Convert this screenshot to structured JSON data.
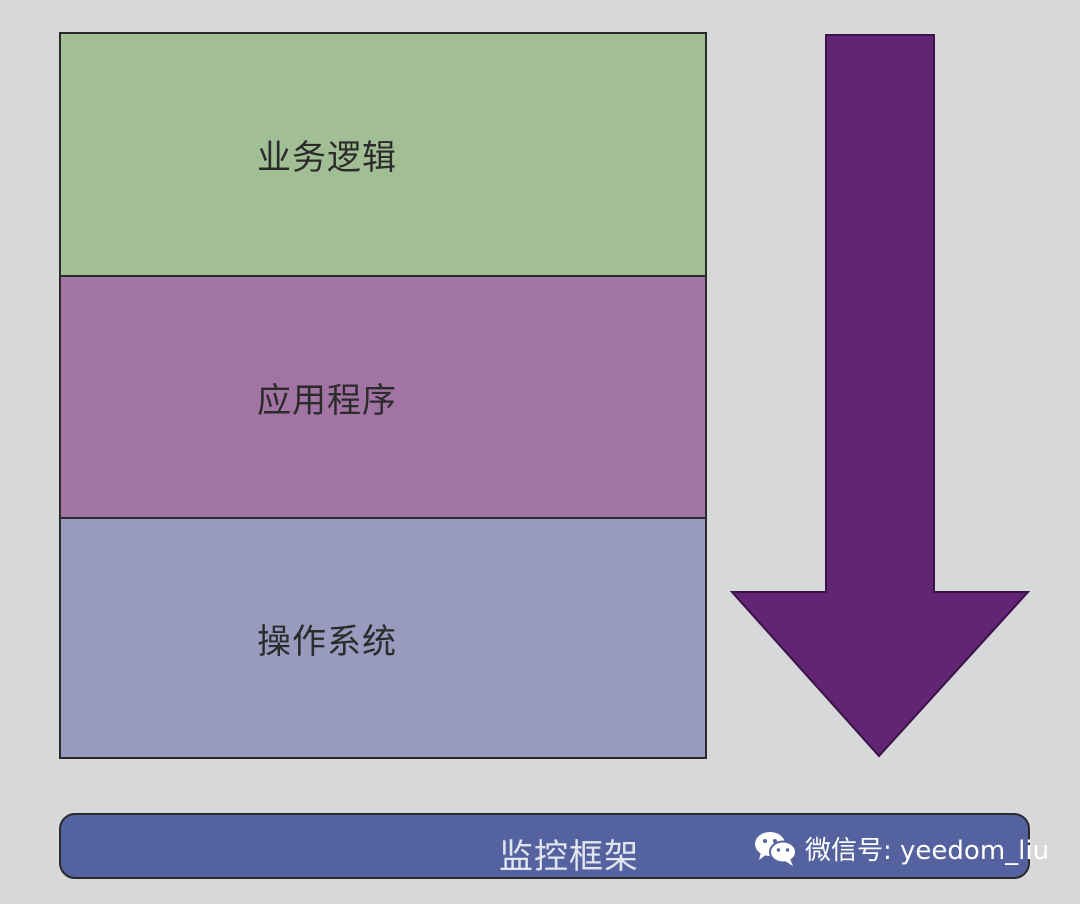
{
  "layers": [
    {
      "label": "业务逻辑",
      "color": "#a2be94"
    },
    {
      "label": "应用程序",
      "color": "#a274a4"
    },
    {
      "label": "操作系统",
      "color": "#989bbe"
    }
  ],
  "arrow": {
    "color": "#612574",
    "direction": "down"
  },
  "framework": {
    "label": "监控框架",
    "color": "#54639f"
  },
  "watermark": {
    "text": "微信号: yeedom_liu",
    "icon": "wechat-icon"
  }
}
